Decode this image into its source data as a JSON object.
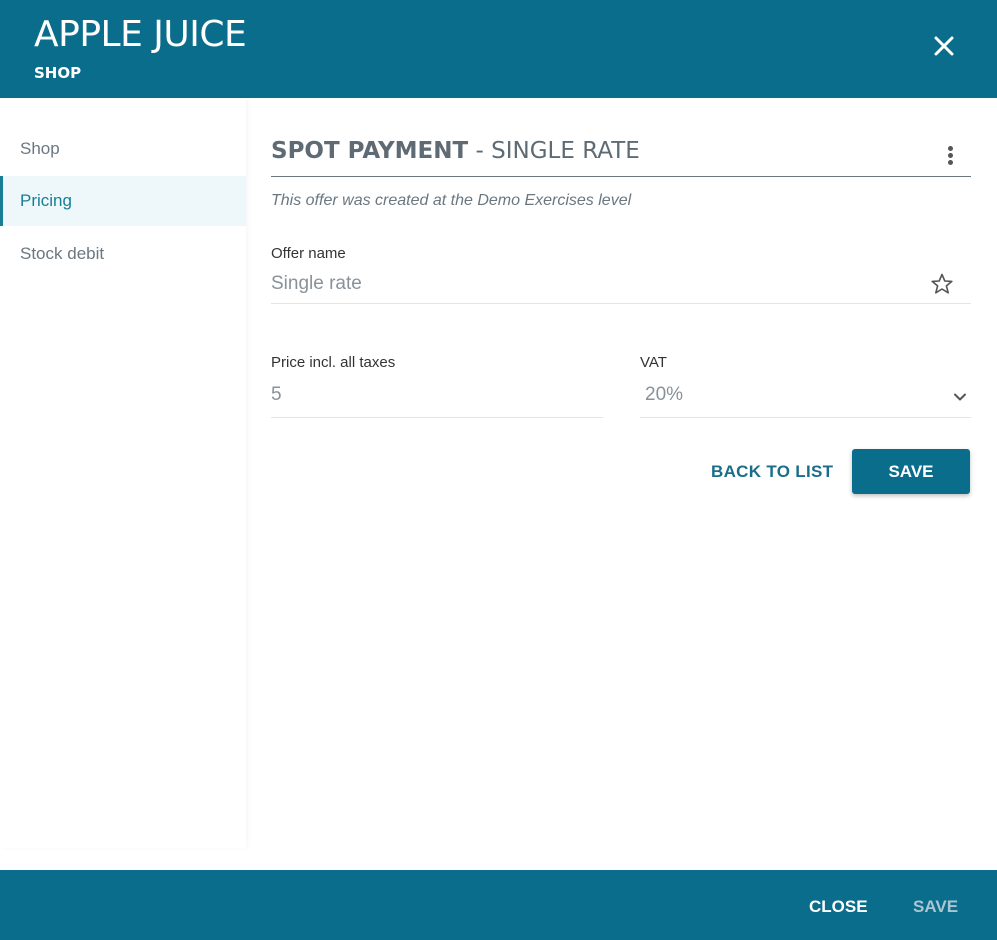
{
  "header": {
    "title": "APPLE JUICE",
    "subtitle": "SHOP",
    "close_icon": "close-icon"
  },
  "sidebar": {
    "items": [
      {
        "label": "Shop",
        "active": false
      },
      {
        "label": "Pricing",
        "active": true
      },
      {
        "label": "Stock debit",
        "active": false
      }
    ]
  },
  "section": {
    "title_strong": "SPOT PAYMENT",
    "title_rest": " - SINGLE RATE",
    "menu_icon": "more-vertical-icon",
    "note": "This offer was created at the Demo Exercises level"
  },
  "form": {
    "offer_name": {
      "label": "Offer name",
      "value": "Single rate",
      "icon": "star-icon"
    },
    "price": {
      "label": "Price incl. all taxes",
      "value": "5"
    },
    "vat": {
      "label": "VAT",
      "value": "20%",
      "icon": "chevron-down-icon"
    }
  },
  "actions": {
    "back_label": "BACK TO LIST",
    "save_label": "SAVE"
  },
  "footer": {
    "close_label": "CLOSE",
    "save_label": "SAVE"
  },
  "colors": {
    "primary": "#0a6d8c",
    "active_text": "#1a7d96",
    "disabled_footer_text": "#a9c6d2"
  }
}
